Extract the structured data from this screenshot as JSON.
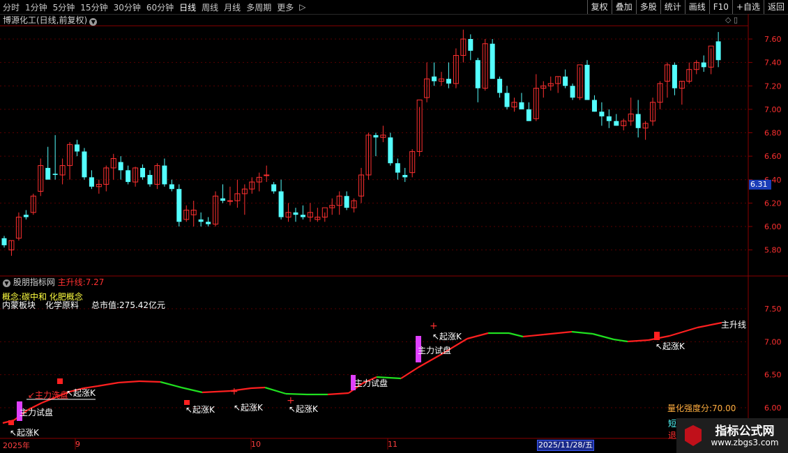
{
  "toolbar": {
    "periods": [
      "分时",
      "1分钟",
      "5分钟",
      "15分钟",
      "30分钟",
      "60分钟",
      "日线",
      "周线",
      "月线",
      "多周期",
      "更多"
    ],
    "active": "日线",
    "more_arrow": "▷",
    "right": [
      "复权",
      "叠加",
      "多股",
      "统计",
      "画线",
      "F10",
      "+自选",
      "返回"
    ]
  },
  "stock": {
    "title": "博源化工(日线,前复权)",
    "circle_icon": "▼"
  },
  "price_axis": [
    "7.60",
    "7.40",
    "7.20",
    "7.00",
    "6.80",
    "6.60",
    "6.40",
    "6.20",
    "6.00",
    "5.80"
  ],
  "current_price": "6.31",
  "indicator": {
    "name": "股朋指标网",
    "line_label": "主升线:",
    "line_value": "7.27",
    "concept": "概念:碳中和 化肥概念",
    "sector": "内蒙板块",
    "industry": "化学原料",
    "market_cap": "总市值:275.42亿元",
    "strength": "量化强度分:70.00",
    "end_label": "主升线",
    "axis": [
      "7.50",
      "7.00",
      "6.50",
      "6.00"
    ],
    "side1": "短",
    "side2": "退"
  },
  "annotations": {
    "qizhang": "↖起涨K",
    "shipan": "主力试盘",
    "xipan": "↙主力洗盘"
  },
  "date_axis": {
    "year": "2025年",
    "m9": "9",
    "m10": "10",
    "m11": "11",
    "cursor": "2025/11/28/五"
  },
  "colors": {
    "up": "#ff3030",
    "down": "#54ffff",
    "line_up": "#ff2020",
    "line_down": "#20e020",
    "magenta": "#e040ff"
  },
  "watermark": {
    "title": "指标公式网",
    "url": "www.zbgs3.com"
  }
}
